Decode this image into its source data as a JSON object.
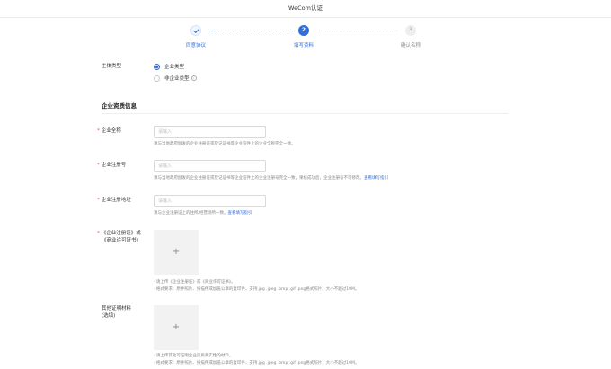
{
  "window": {
    "title": "WeCom认证"
  },
  "steps": [
    {
      "label": "同意协议",
      "number": "",
      "state": "done"
    },
    {
      "label": "填写资料",
      "number": "2",
      "state": "active"
    },
    {
      "label": "确认名称",
      "number": "3",
      "state": "todo"
    }
  ],
  "subject_type": {
    "label": "主体类型",
    "options": [
      {
        "label": "企业类型",
        "selected": true
      },
      {
        "label": "非企业类型",
        "selected": false,
        "icon": "info-icon"
      }
    ]
  },
  "section": {
    "title": "企业资质信息"
  },
  "fields": {
    "full_name": {
      "required_mark": "*",
      "label": "企业全称",
      "placeholder": "请输入",
      "value": "",
      "hint": "须与当地政府颁发的企业注册证或登记证书等企业证件上的企业全称完全一致。"
    },
    "reg_number": {
      "required_mark": "*",
      "label": "企业注册号",
      "placeholder": "请输入",
      "value": "",
      "hint": "须与当地政府颁发的企业注册证或登记证书等企业证件上的企业注册号完全一致，果核成功后，企业注册号不可修改。",
      "link": "查看填写指引"
    },
    "reg_address": {
      "required_mark": "*",
      "label": "企业注册地址",
      "placeholder": "请输入",
      "value": "",
      "hint": "须与企业注册证上的住所/经营场所一致。",
      "link": "查看填写指引"
    }
  },
  "uploads": {
    "license": {
      "required_mark": "*",
      "label_line1": "《企业注册证》或",
      "label_line2": "《商业许可证书》",
      "icon": "plus-icon",
      "hint_line1": "· 请上传《企业注册证》或《商业许可证书》。",
      "hint_line2": "· 格式要求：原件照片、扫描件或加盖公章的复印件，支持.jpg .jpeg .bmp .gif .png格式照片，大小不超过10M。"
    },
    "other": {
      "label_line1": "其他证明材料",
      "label_line2": "(选填)",
      "icon": "plus-icon",
      "hint_line1": "· 请上传其他可证明企业资质真实性的材料。",
      "hint_line2": "· 格式要求：原件照片、扫描件或加盖公章的复印件，支持.jpg .jpeg .bmp .gif .png格式照片，大小不超过10M。"
    }
  },
  "colors": {
    "accent": "#2f6fe0",
    "required": "#e34d4d",
    "hint": "#888888",
    "upload_bg": "#f2f2f2"
  }
}
